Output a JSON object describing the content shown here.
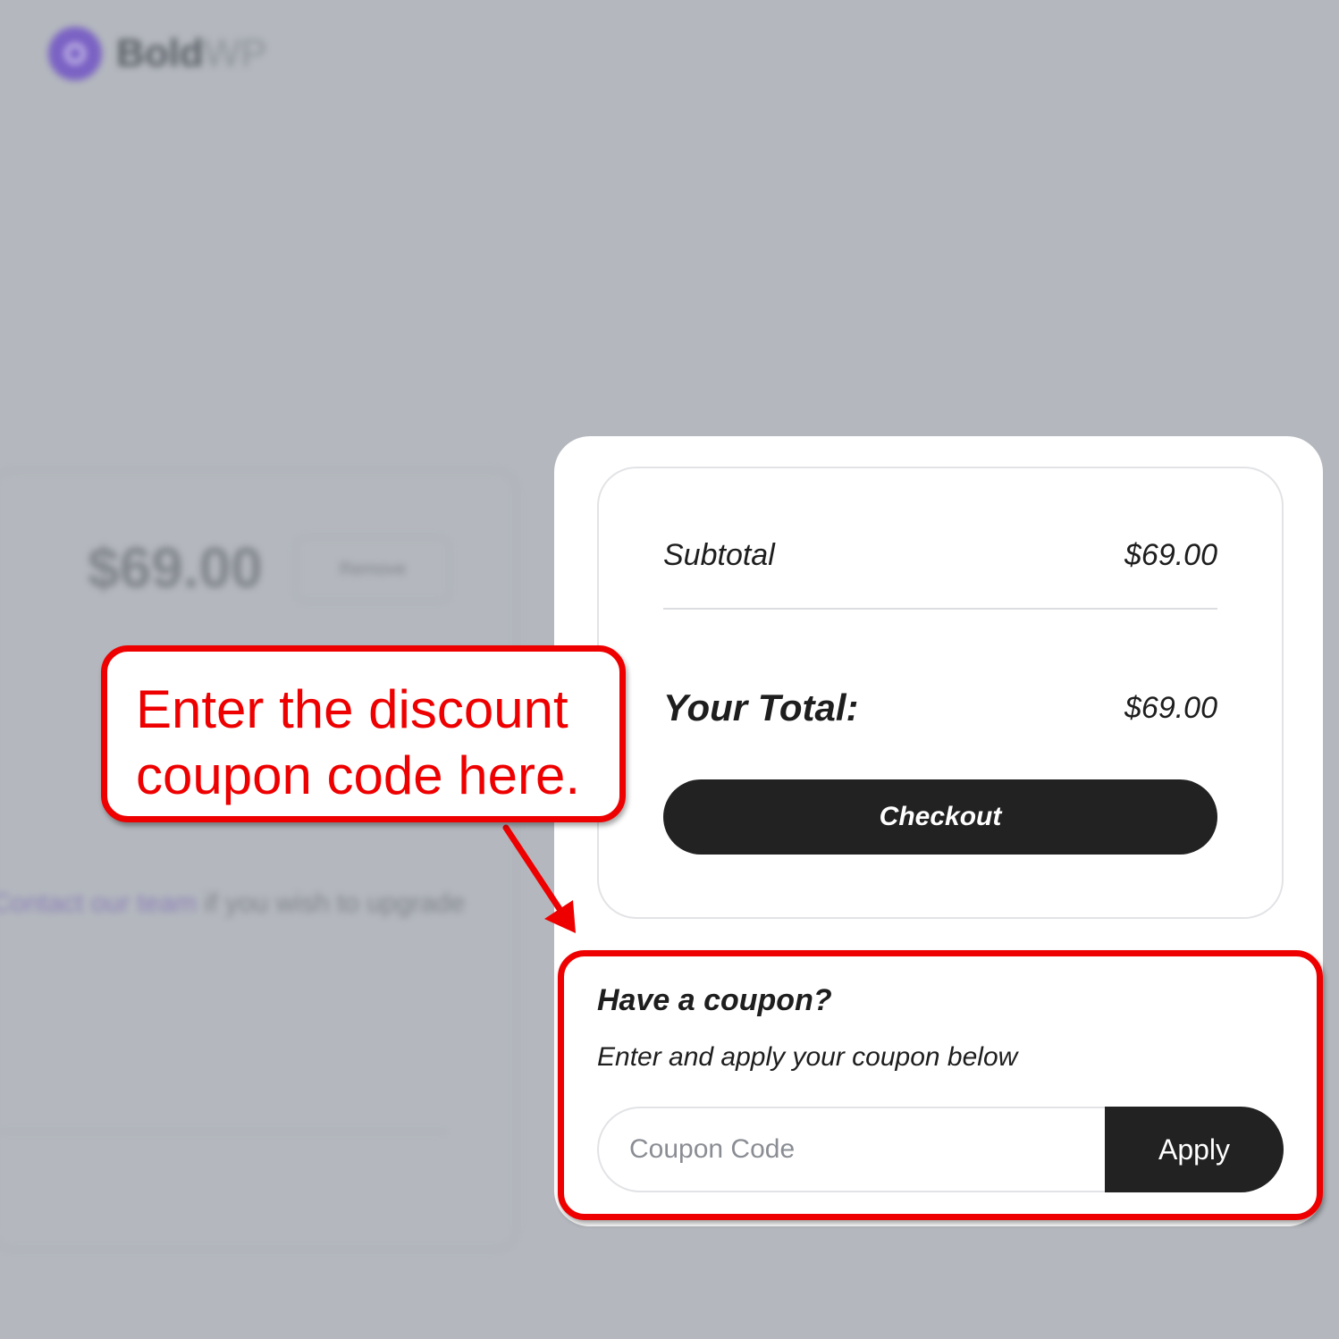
{
  "background": {
    "logo_text_bold": "Bold",
    "logo_text_light": "WP",
    "price": "$69.00",
    "remove_label": "Remove",
    "upgrade_link": "Contact our team",
    "upgrade_text": " if you wish to upgrade"
  },
  "summary": {
    "subtotal_label": "Subtotal",
    "subtotal_value": "$69.00",
    "total_label": "Your Total:",
    "total_value": "$69.00",
    "checkout_label": "Checkout"
  },
  "coupon": {
    "title": "Have a coupon?",
    "subtitle": "Enter and apply your coupon below",
    "input_placeholder": "Coupon Code",
    "input_value": "",
    "apply_label": "Apply"
  },
  "annotation": {
    "callout_line1": "Enter the discount",
    "callout_line2": "coupon code here.",
    "color": "#ee0000"
  },
  "colors": {
    "overlay": "#b4b8be",
    "button_dark": "#222222",
    "brand_purple": "#7a62c4"
  }
}
